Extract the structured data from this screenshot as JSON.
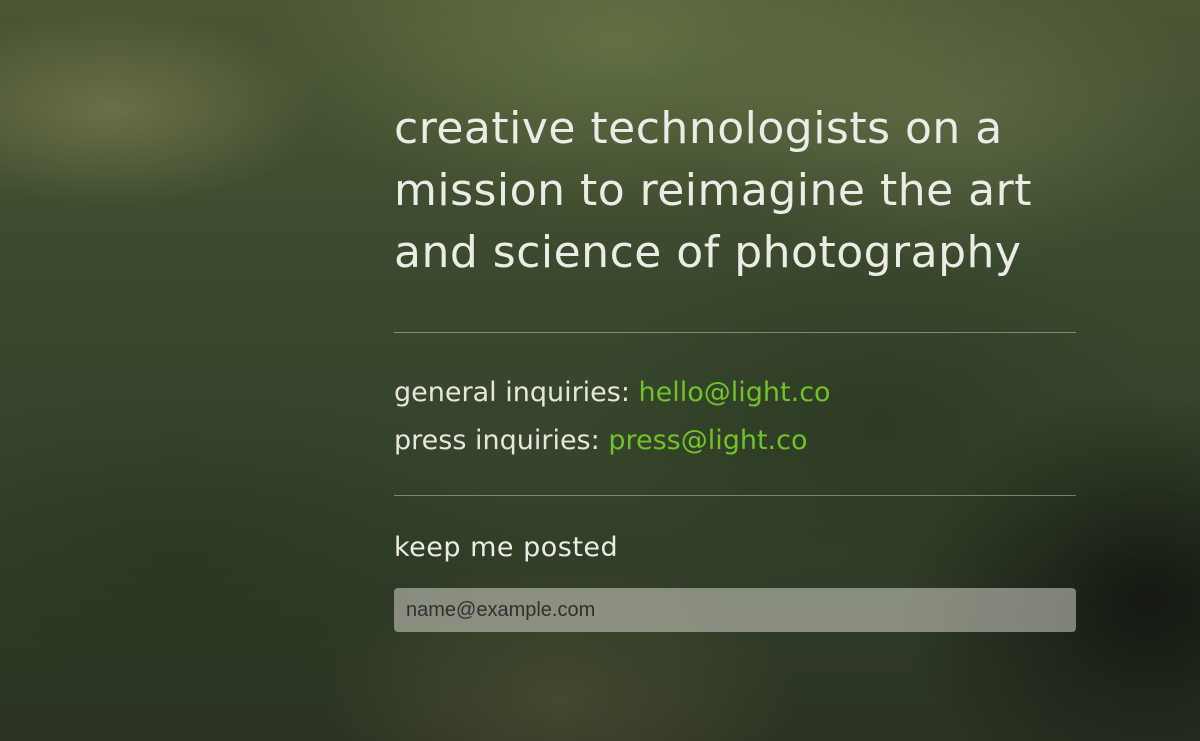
{
  "headline": {
    "lines": [
      "creative technologists on a",
      "mission to reimagine the art",
      "and science of photography"
    ]
  },
  "contacts": {
    "general": {
      "label": "general inquiries:",
      "email": "hello@light.co"
    },
    "press": {
      "label": "press inquiries:",
      "email": "press@light.co"
    }
  },
  "signup": {
    "heading": "keep me posted",
    "placeholder": "name@example.com",
    "value": ""
  },
  "colors": {
    "link": "#6fc22a",
    "text": "#ecece6"
  }
}
